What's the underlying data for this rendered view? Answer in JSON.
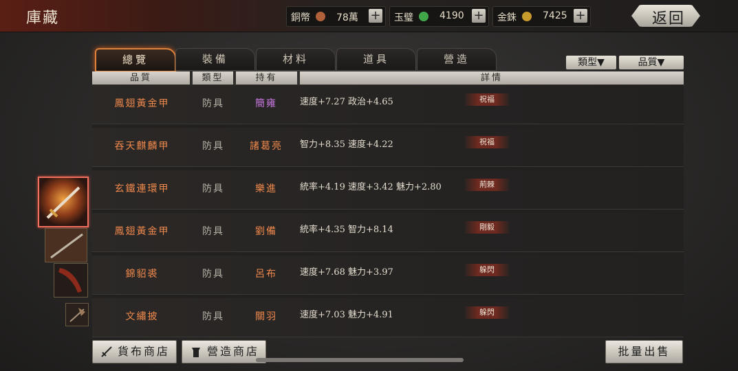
{
  "header": {
    "title": "庫藏",
    "back_label": "返回",
    "resources": [
      {
        "label": "銅幣",
        "value": "78萬",
        "coin_color": "#b0613a",
        "plus": "+"
      },
      {
        "label": "玉璧",
        "value": "4190",
        "coin_color": "#3fa74a",
        "plus": "+"
      },
      {
        "label": "金銖",
        "value": "7425",
        "coin_color": "#c99a2c",
        "plus": "+"
      }
    ]
  },
  "tabs": [
    {
      "label": "總覽",
      "active": true
    },
    {
      "label": "裝備"
    },
    {
      "label": "材料"
    },
    {
      "label": "道具"
    },
    {
      "label": "營造"
    }
  ],
  "filters": [
    {
      "label": "類型▼"
    },
    {
      "label": "品質▼"
    }
  ],
  "columns": [
    "品質",
    "類型",
    "持有",
    "詳情"
  ],
  "rows": [
    {
      "name": "鳳翅黃金甲",
      "type": "防具",
      "owner": "簡雍",
      "owner_color": "#c878e0",
      "detail": "速度+7.27 政治+4.65",
      "tag": "祝福"
    },
    {
      "name": "吞天麒麟甲",
      "type": "防具",
      "owner": "諸葛亮",
      "owner_color": "#f0894c",
      "detail": "智力+8.35 速度+4.22",
      "tag": "祝福"
    },
    {
      "name": "玄鐵連環甲",
      "type": "防具",
      "owner": "樂進",
      "owner_color": "#f0894c",
      "detail": "統率+4.19 速度+3.42 魅力+2.80",
      "tag": "荊棘"
    },
    {
      "name": "鳳翅黃金甲",
      "type": "防具",
      "owner": "劉備",
      "owner_color": "#f0894c",
      "detail": "統率+4.35 智力+8.14",
      "tag": "剛毅"
    },
    {
      "name": "錦貂裘",
      "type": "防具",
      "owner": "呂布",
      "owner_color": "#f0894c",
      "detail": "速度+7.68 魅力+3.97",
      "tag": "躲閃"
    },
    {
      "name": "文繡披",
      "type": "防具",
      "owner": "關羽",
      "owner_color": "#f0894c",
      "detail": "速度+7.03 魅力+4.91",
      "tag": "躲閃"
    }
  ],
  "bottom": {
    "currency_shop": "貨布商店",
    "build_shop": "營造商店",
    "bulk_sell": "批量出售"
  }
}
